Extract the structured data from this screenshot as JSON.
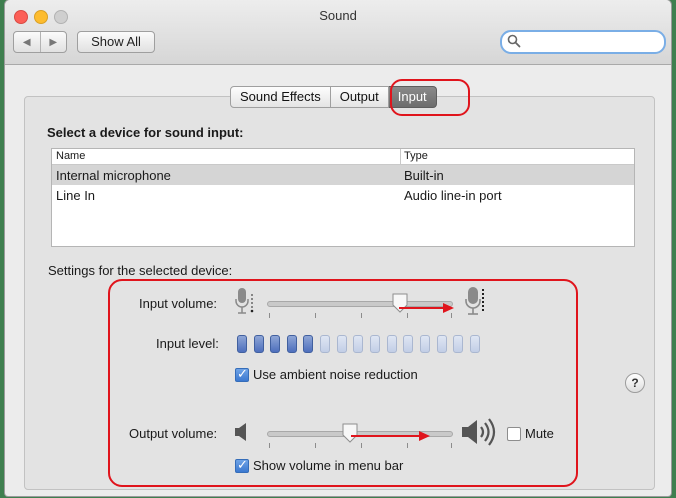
{
  "window": {
    "title": "Sound",
    "show_all_label": "Show All",
    "search": {
      "value": "",
      "placeholder": ""
    }
  },
  "tabs": [
    {
      "label": "Sound Effects",
      "active": false
    },
    {
      "label": "Output",
      "active": false
    },
    {
      "label": "Input",
      "active": true
    }
  ],
  "device_section": {
    "heading": "Select a device for sound input:",
    "columns": [
      "Name",
      "Type"
    ],
    "rows": [
      {
        "name": "Internal microphone",
        "type": "Built-in",
        "selected": true
      },
      {
        "name": "Line In",
        "type": "Audio line-in port",
        "selected": false
      }
    ]
  },
  "settings": {
    "heading": "Settings for the selected device:",
    "input_volume": {
      "label": "Input volume:",
      "value_fraction": 0.72
    },
    "input_level": {
      "label": "Input level:",
      "total_bars": 15,
      "lit_bars": 5
    },
    "ambient_noise": {
      "label": "Use ambient noise reduction",
      "checked": true
    },
    "output_volume": {
      "label": "Output volume:",
      "value_fraction": 0.44
    },
    "mute": {
      "label": "Mute",
      "checked": false
    },
    "menu_bar_volume": {
      "label": "Show volume in menu bar",
      "checked": true
    }
  },
  "help_label": "?",
  "colors": {
    "annotation": "#e0141c",
    "level_on": "#4e6fbd",
    "level_off": "#c2cee6",
    "active_tab": "#6d6d6d"
  },
  "icons": {
    "back": "chevron-left-icon",
    "forward": "chevron-right-icon",
    "grid": "grid-icon",
    "search": "search-icon",
    "mic_low": "microphone-low-icon",
    "mic_high": "microphone-high-icon",
    "speaker_low": "speaker-low-icon",
    "speaker_high": "speaker-high-icon"
  }
}
